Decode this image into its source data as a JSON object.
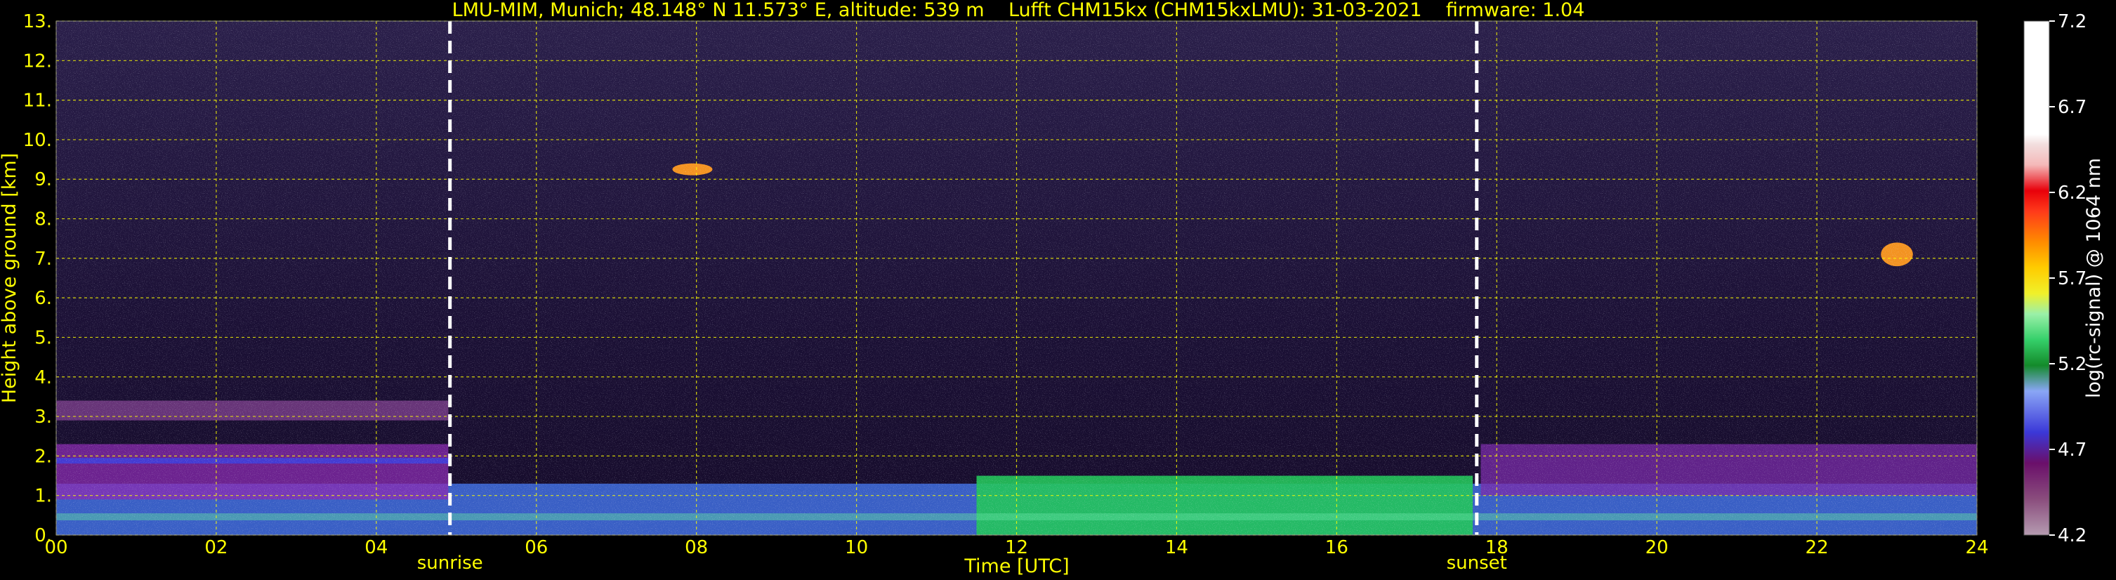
{
  "chart_data": {
    "type": "heatmap",
    "title": "LMU-MIM, Munich; 48.148° N 11.573° E, altitude: 539 m    Lufft CHM15kx (CHM15kxLMU): 31-03-2021    firmware: 1.04",
    "xlabel": "Time [UTC]",
    "ylabel": "Height above ground [km]",
    "xlim": [
      0,
      24
    ],
    "ylim": [
      0,
      13
    ],
    "x_ticks": [
      "00",
      "02",
      "04",
      "06",
      "08",
      "10",
      "12",
      "14",
      "16",
      "18",
      "20",
      "22",
      "24"
    ],
    "y_ticks": [
      "0.",
      "1.",
      "2.",
      "3.",
      "4.",
      "5.",
      "6.",
      "7.",
      "8.",
      "9.",
      "10.",
      "11.",
      "12.",
      "13."
    ],
    "grid": true,
    "colorbar": {
      "label": "log(rc-signal) @ 1064 nm",
      "range": [
        4.2,
        7.2
      ],
      "ticks": [
        "7.2",
        "6.7",
        "6.2",
        "5.7",
        "5.2",
        "4.7",
        "4.2"
      ]
    },
    "events": [
      {
        "label": "sunrise",
        "time": 4.92
      },
      {
        "label": "sunset",
        "time": 17.75
      }
    ],
    "layers": [
      {
        "feature": "surface layer (green/blue)",
        "time_start": 0,
        "time_end": 24,
        "height_min": 0,
        "height_max": 1.3
      },
      {
        "feature": "residual layer (purple/blue)",
        "time_start": 0,
        "time_end": 4.9,
        "height_min": 0.9,
        "height_max": 2.3
      },
      {
        "feature": "elevated aerosol layer",
        "time_start": 0,
        "time_end": 4.9,
        "height_min": 2.9,
        "height_max": 3.4
      },
      {
        "feature": "daytime mixing layer (green)",
        "time_start": 11.5,
        "time_end": 17.7,
        "height_min": 0,
        "height_max": 1.5
      },
      {
        "feature": "evening residual layer",
        "time_start": 17.8,
        "time_end": 24,
        "height_min": 1.0,
        "height_max": 2.3
      },
      {
        "feature": "cloud",
        "time_start": 7.7,
        "time_end": 8.2,
        "height_min": 9.1,
        "height_max": 9.4
      },
      {
        "feature": "cloud",
        "time_start": 22.8,
        "time_end": 23.2,
        "height_min": 6.8,
        "height_max": 7.4
      }
    ]
  },
  "colors": {
    "text": "#ffff00",
    "grid": "#ffff00",
    "background": "#1a0f33",
    "event_line": "#ffffff"
  }
}
